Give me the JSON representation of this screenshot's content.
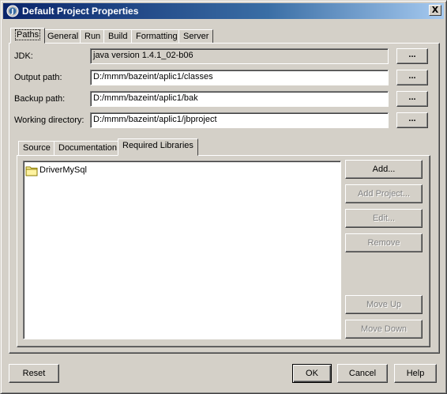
{
  "window": {
    "title": "Default Project Properties",
    "close_label": "X"
  },
  "tabs": [
    {
      "label": "Paths",
      "active": true
    },
    {
      "label": "General"
    },
    {
      "label": "Run"
    },
    {
      "label": "Build"
    },
    {
      "label": "Formatting"
    },
    {
      "label": "Server"
    }
  ],
  "fields": {
    "jdk": {
      "label": "JDK:",
      "value": "java version 1.4.1_02-b06"
    },
    "output": {
      "label": "Output path:",
      "value": "D:/mmm/bazeint/aplic1/classes"
    },
    "backup": {
      "label": "Backup path:",
      "value": "D:/mmm/bazeint/aplic1/bak"
    },
    "working": {
      "label": "Working directory:",
      "value": "D:/mmm/bazeint/aplic1/jbproject"
    },
    "browse_label": "..."
  },
  "inner_tabs": [
    {
      "label": "Source"
    },
    {
      "label": "Documentation"
    },
    {
      "label": "Required Libraries",
      "active": true
    }
  ],
  "libraries": [
    {
      "name": "DriverMySql",
      "icon": "folder-icon"
    }
  ],
  "side_buttons": {
    "add": "Add...",
    "add_project": "Add Project...",
    "edit": "Edit...",
    "remove": "Remove",
    "move_up": "Move Up",
    "move_down": "Move Down"
  },
  "bottom_buttons": {
    "reset": "Reset",
    "ok": "OK",
    "cancel": "Cancel",
    "help": "Help"
  },
  "colors": {
    "titlebar_start": "#0a246a",
    "face": "#d4d0c8"
  }
}
